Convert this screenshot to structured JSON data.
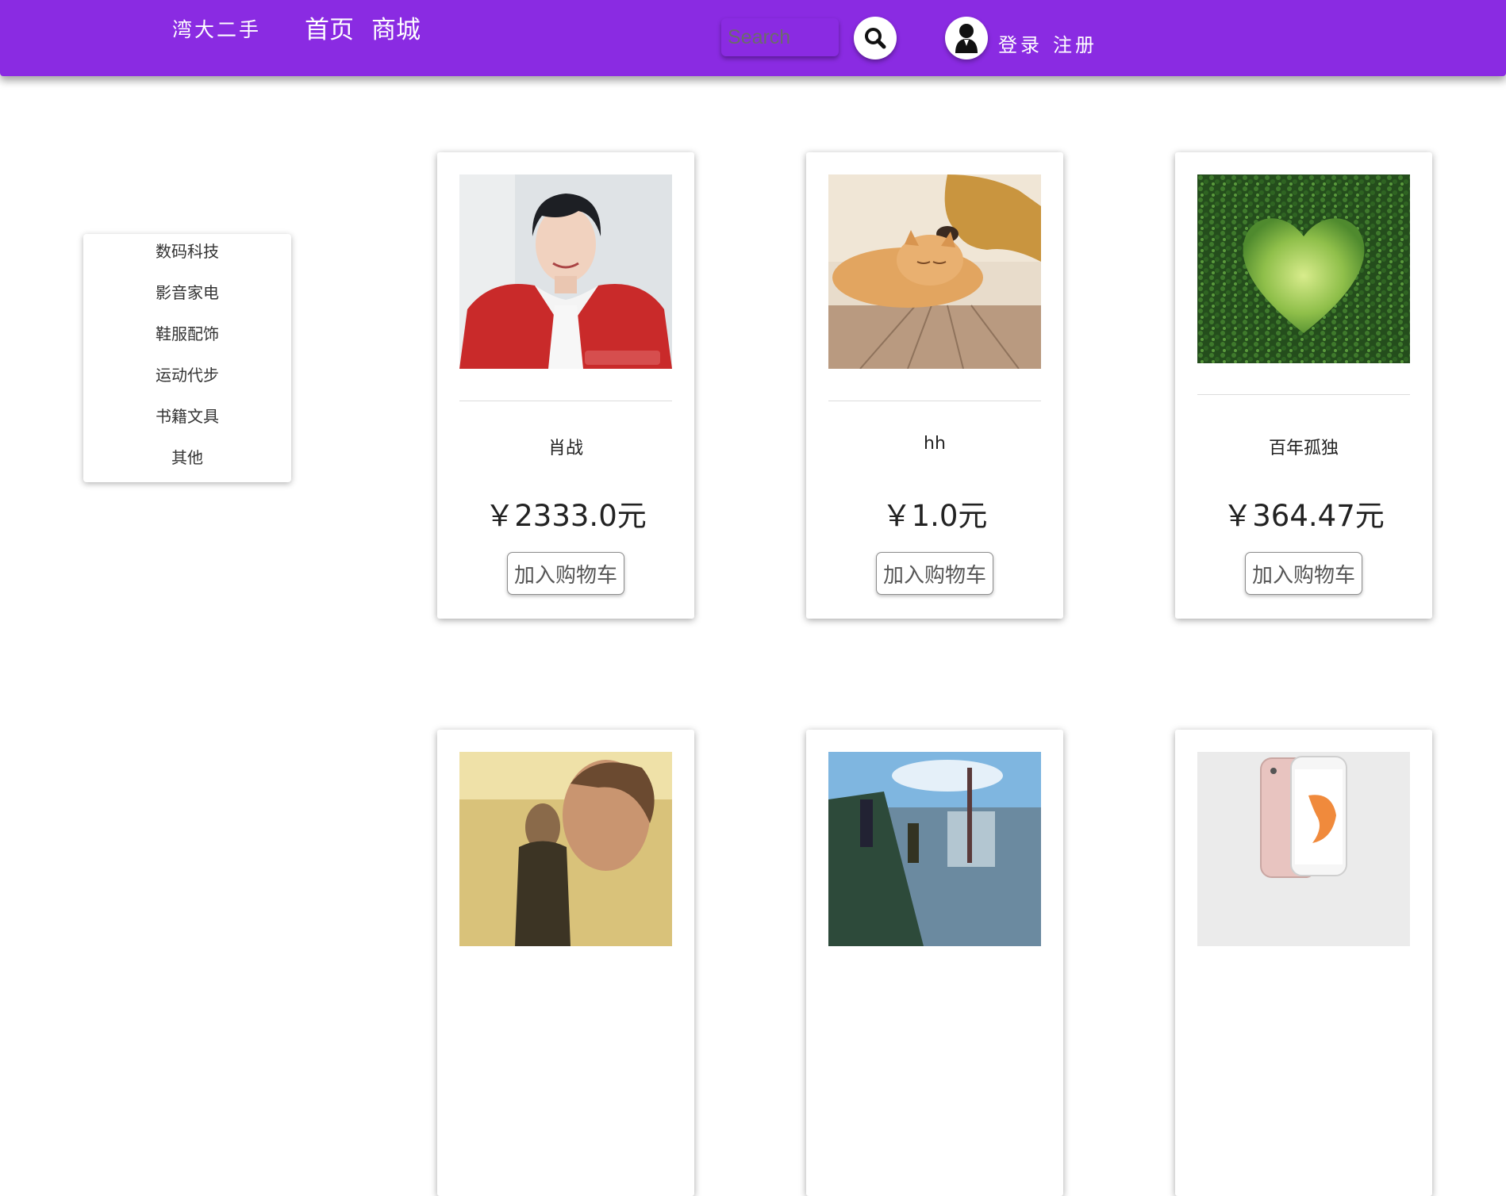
{
  "header": {
    "brand": "湾大二手",
    "nav": {
      "home": "首页",
      "mall": "商城"
    },
    "search": {
      "placeholder": "Search",
      "icon": "search-icon"
    },
    "user": {
      "icon": "user-icon",
      "login": "登录",
      "register": "注册"
    },
    "colors": {
      "navbar": "#8a2be2"
    }
  },
  "sidebar": {
    "items": [
      {
        "label": "数码科技"
      },
      {
        "label": "影音家电"
      },
      {
        "label": "鞋服配饰"
      },
      {
        "label": "运动代步"
      },
      {
        "label": "书籍文具"
      },
      {
        "label": "其他"
      }
    ]
  },
  "products": [
    {
      "name": "肖战",
      "price": "￥2333.0元",
      "button": "加入购物车",
      "image": "portrait-photo"
    },
    {
      "name": "hh",
      "price": "￥1.0元",
      "button": "加入购物车",
      "image": "dog-cat-photo"
    },
    {
      "name": "百年孤独",
      "price": "￥364.47元",
      "button": "加入购物车",
      "image": "heart-hedge-photo"
    },
    {
      "image": "movie-still-photo"
    },
    {
      "image": "anime-scene-photo"
    },
    {
      "image": "phone-photo"
    }
  ]
}
